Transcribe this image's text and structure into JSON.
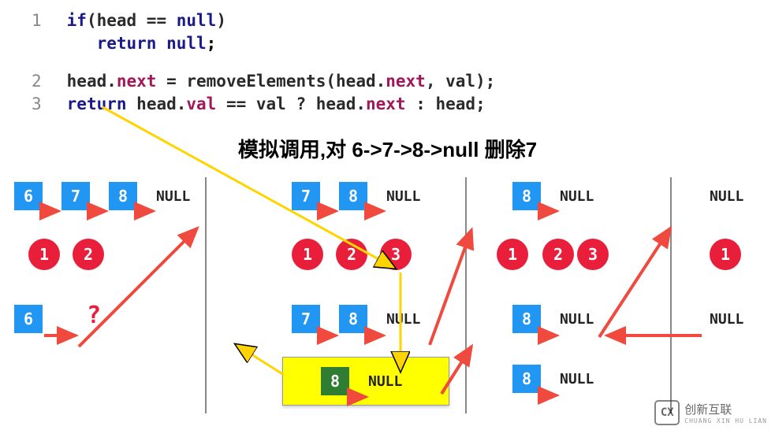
{
  "code": {
    "line1": {
      "num": "1",
      "pre": "if",
      "cond_l": "(head == ",
      "null_": "null",
      "cond_r": ")"
    },
    "line1b": {
      "ret": "return ",
      "null_": "null",
      "semi": ";"
    },
    "line2": {
      "num": "2",
      "head": "head.",
      "next": "next",
      "eq": " = removeElements(head.",
      "next2": "next",
      "rest": ", val);"
    },
    "line3": {
      "num": "3",
      "ret": "return ",
      "head": "head.",
      "val": "val",
      "mid": " == val ? head.",
      "next": "next",
      "rest": " : head;"
    }
  },
  "title": "模拟调用,对 6->7->8->null 删除7",
  "labels": {
    "NULL": "NULL",
    "q": "?",
    "n1": "1",
    "n2": "2",
    "n3": "3",
    "v6": "6",
    "v7": "7",
    "v8": "8"
  },
  "logo": {
    "cx": "CX",
    "name": "创新互联",
    "sub": "CHUANG XIN HU LIAN"
  }
}
